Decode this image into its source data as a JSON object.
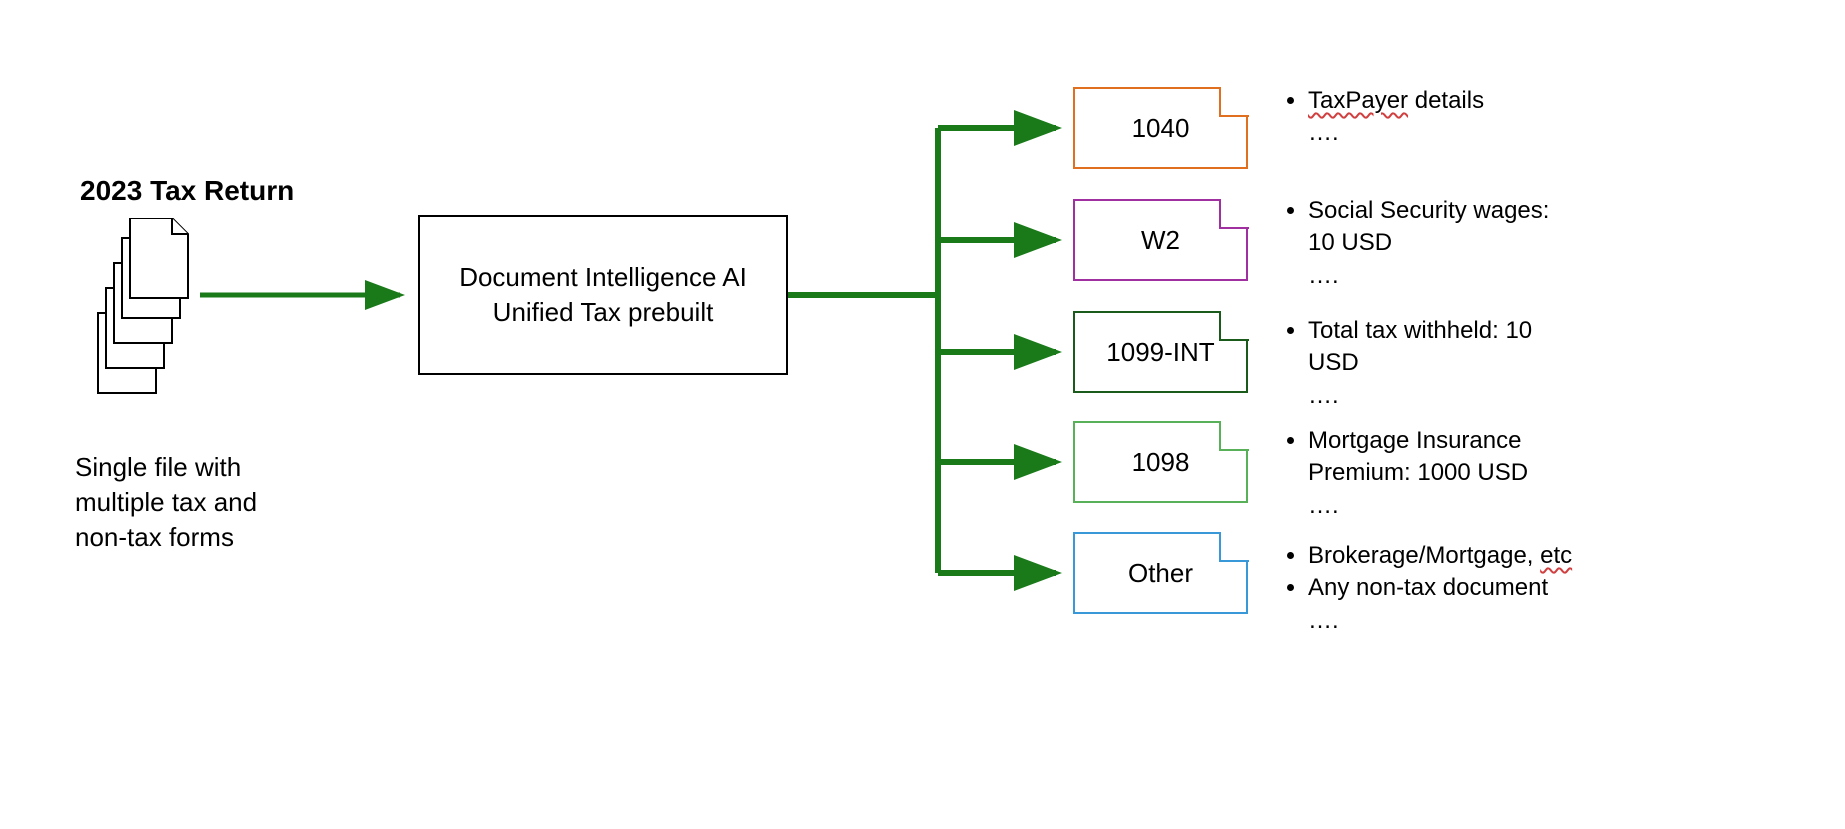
{
  "input": {
    "title": "2023 Tax Return",
    "subtitle": "Single file with multiple tax and non-tax forms"
  },
  "processor": {
    "line1": "Document Intelligence AI",
    "line2": "Unified Tax prebuilt"
  },
  "outputs": [
    {
      "label": "1040",
      "color": "#e07020",
      "details": [
        {
          "text": "TaxPayer details",
          "wavy": "TaxPayer"
        }
      ],
      "trailing": "…."
    },
    {
      "label": "W2",
      "color": "#a030a0",
      "details": [
        {
          "text": "Social Security wages: 10 USD"
        }
      ],
      "trailing": "…."
    },
    {
      "label": "1099-INT",
      "color": "#1a5a1a",
      "details": [
        {
          "text": "Total tax withheld: 10 USD"
        }
      ],
      "trailing": "…."
    },
    {
      "label": "1098",
      "color": "#58b058",
      "details": [
        {
          "text": "Mortgage Insurance Premium: 1000 USD"
        }
      ],
      "trailing": "…."
    },
    {
      "label": "Other",
      "color": "#3898d8",
      "details": [
        {
          "text": "Brokerage/Mortgage, etc",
          "wavy": "etc"
        },
        {
          "text": "Any non-tax document"
        }
      ],
      "trailing": "…."
    }
  ],
  "colors": {
    "arrow": "#1a7a1a"
  }
}
